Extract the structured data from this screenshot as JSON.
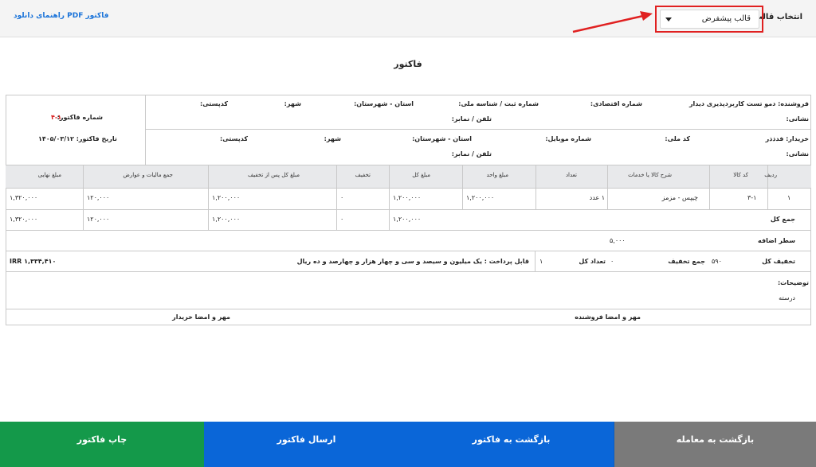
{
  "topbar": {
    "help_link": "راهنمای دانلود PDF فاکتور",
    "template_label": "انتخاب قالب",
    "template_value": "قالب پیشفرض"
  },
  "invoice": {
    "title": "فاکتور",
    "invoice_number_label": "شماره فاکتور:",
    "invoice_number_value": "۴-۱",
    "invoice_date": "تاریخ فاکتور: ۱۴۰۵/۰۳/۱۲",
    "seller": {
      "name": "فروشنده: دمو تست کاربردپذیری دیدار",
      "economic_code": "شماره اقتصادی:",
      "reg_id": "شماره ثبت / شناسه ملی:",
      "province": "استان - شهرستان:",
      "city": "شهر:",
      "postal": "کدپستی:",
      "address": "نشانی:",
      "phone": "تلفن / نمابر:"
    },
    "buyer": {
      "name": "خریدار: فدذذر",
      "national_code": "کد ملی:",
      "mobile": "شماره موبایل:",
      "province": "استان - شهرستان:",
      "city": "شهر:",
      "postal": "کدپستی:",
      "address": "نشانی:",
      "phone": "تلفن / نمابر:"
    },
    "columns": [
      "ردیف",
      "کد کالا",
      "شرح کالا یا خدمات",
      "تعداد",
      "مبلغ واحد",
      "مبلغ کل",
      "تخفیف",
      "مبلغ کل پس از تخفیف",
      "جمع مالیات و عوارض",
      "مبلغ نهایی"
    ],
    "row": {
      "index": "۱",
      "code": "۳-۱",
      "desc": "چیپس - مزمز",
      "qty": "۱ عدد",
      "unit_price": "۱,۲۰۰,۰۰۰",
      "total": "۱,۲۰۰,۰۰۰",
      "discount": "۰",
      "after_discount": "۱,۲۰۰,۰۰۰",
      "tax": "۱۲۰,۰۰۰",
      "final": "۱,۳۲۰,۰۰۰"
    },
    "sum": {
      "label": "جمع کل",
      "total": "۱,۲۰۰,۰۰۰",
      "discount": "۰",
      "after_discount": "۱,۲۰۰,۰۰۰",
      "tax": "۱۲۰,۰۰۰",
      "final": "۱,۳۲۰,۰۰۰"
    },
    "extra_row_label": "سطر اضافه",
    "extra_row_value": "۵,۰۰۰",
    "total_discount_label": "تخفیف کل",
    "total_discount_value": "۵۹۰",
    "discount_sum_label": "جمع تخفیف",
    "discount_sum_value": "۰",
    "count_label": "تعداد کل",
    "count_value": "۱",
    "payable_text": "قابل پرداخت : یک میلیون و سیصد و سی و چهار هزار و چهارصد و ده ریال",
    "payable_amount": "IRR ۱,۳۳۴,۴۱۰",
    "notes_label": "توضیحات:",
    "notes_value": "درسته",
    "seller_sign": "مهر و امضا فروشنده",
    "buyer_sign": "مهر و امضا خریدار"
  },
  "buttons": {
    "back_deal": "بازگشت به معامله",
    "back_invoice": "بازگشت به فاکتور",
    "send": "ارسال فاکتور",
    "print": "چاپ فاکتور"
  },
  "colors": {
    "back_deal": "#7a7a7a",
    "back_invoice": "#0a66d8",
    "send": "#0a66d8",
    "print": "#14994a",
    "annotation": "#e02020"
  }
}
